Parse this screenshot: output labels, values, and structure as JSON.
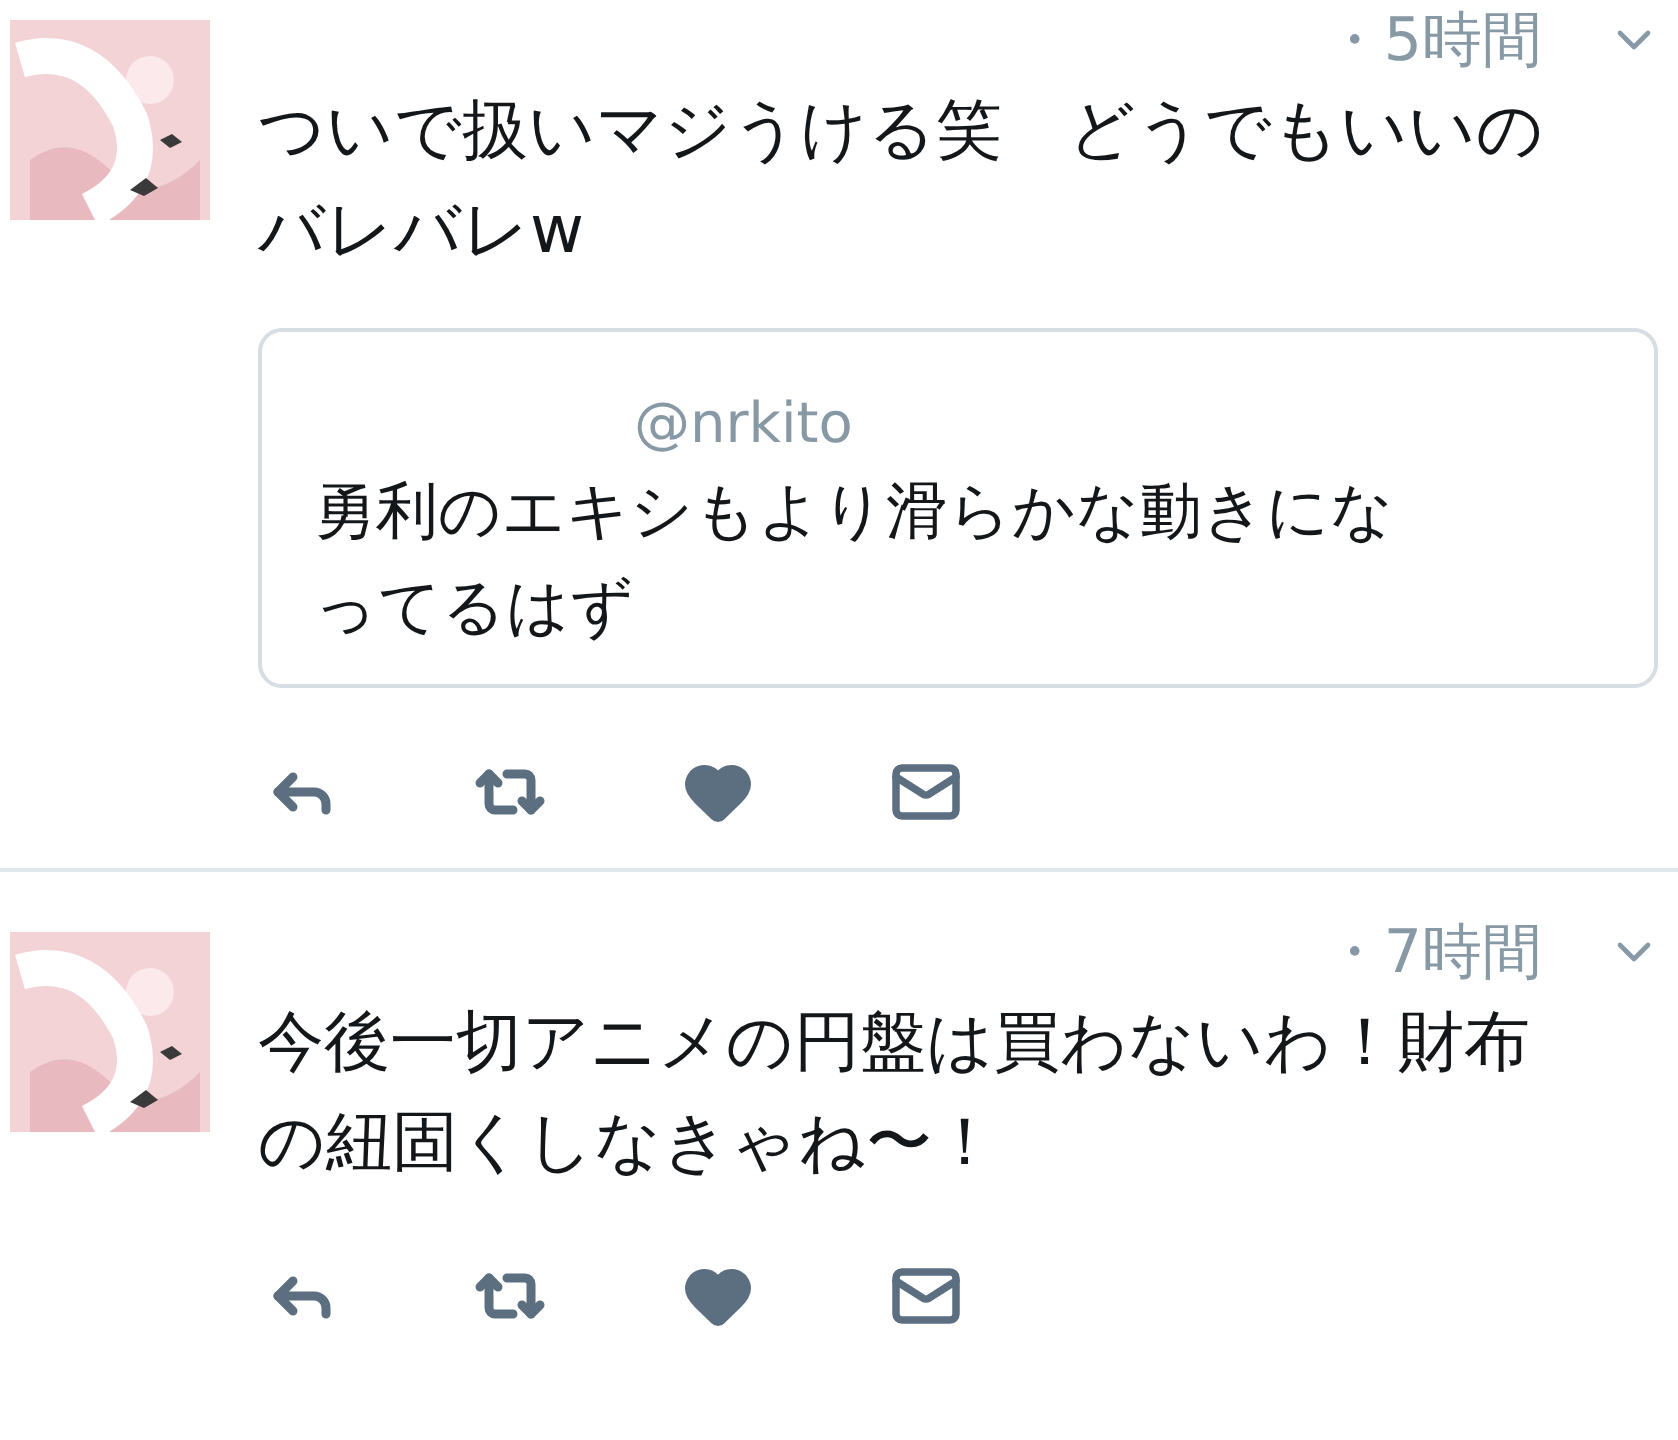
{
  "tweets": [
    {
      "time": "・5時間",
      "text": [
        "ついで扱いマジうける笑　どうでもいいの",
        "バレバレw"
      ],
      "quote": {
        "handle": "@nrkito",
        "text": [
          "勇利のエキシもより滑らかな動きにな",
          "ってるはず"
        ]
      }
    },
    {
      "time": "・7時間",
      "text": [
        "今後一切アニメの円盤は買わないわ！財布",
        "の紐固くしなきゃね〜！"
      ]
    }
  ]
}
